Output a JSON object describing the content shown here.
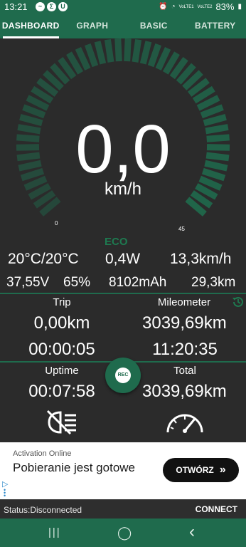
{
  "status_bar": {
    "time": "13:21",
    "left_icons": [
      "messenger-icon",
      "sigma-icon",
      "shield-icon"
    ],
    "right_icons": [
      "alarm-icon",
      "wifi-icon",
      "volte-signal-icon",
      "volte-signal-icon",
      "battery-icon"
    ],
    "volte_label": "VoLTE1",
    "volte2_label": "VoLTE2",
    "battery": "83%"
  },
  "tabs": [
    {
      "label": "DASHBOARD",
      "active": true
    },
    {
      "label": "GRAPH",
      "active": false
    },
    {
      "label": "BASIC",
      "active": false
    },
    {
      "label": "BATTERY",
      "active": false
    }
  ],
  "gauge": {
    "speed": "0,0",
    "unit": "km/h",
    "min_label": "0",
    "max_label": "45",
    "level": 0,
    "mode": "ECO",
    "accent": "#1f6b4d",
    "mode_color": "#1e7a50"
  },
  "stats_row1": {
    "temps": "20°C/20°C",
    "power": "0,4W",
    "avg_speed": "13,3km/h"
  },
  "stats_row2": {
    "voltage": "37,55V",
    "battery_pct": "65%",
    "capacity": "8102mAh",
    "range": "29,3km"
  },
  "trip": {
    "label": "Trip",
    "distance": "0,00km",
    "time": "00:00:05"
  },
  "mileometer": {
    "label": "Mileometer",
    "distance": "3039,69km",
    "time": "11:20:35"
  },
  "uptime": {
    "label": "Uptime",
    "value": "00:07:58"
  },
  "total": {
    "label": "Total",
    "value": "3039,69km"
  },
  "rec_button": {
    "label": "REC"
  },
  "icons": {
    "history": "history-icon",
    "lights": "headlight-off-icon",
    "speedometer": "speedometer-icon"
  },
  "ad": {
    "advertiser": "Activation Online",
    "title": "Pobieranie jest gotowe",
    "button": "OTWÓRZ",
    "button_glyph": "»"
  },
  "status_line": {
    "status": "Status:Disconnected",
    "connect": "CONNECT"
  },
  "nav": {
    "recents": "|||",
    "home": "◯",
    "back": "‹"
  }
}
